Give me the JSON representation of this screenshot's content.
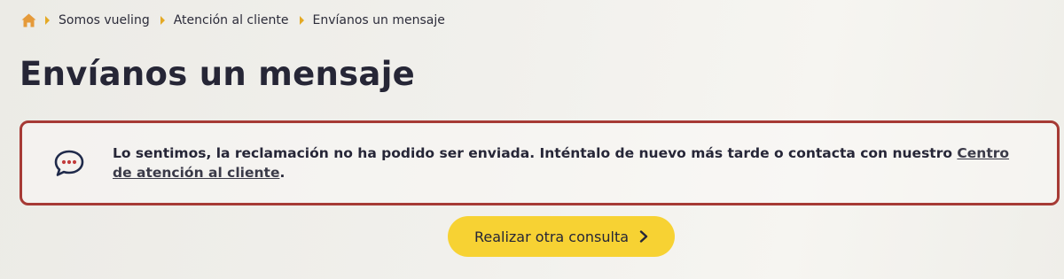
{
  "breadcrumb": {
    "home_icon": "home-icon",
    "items": [
      {
        "label": "Somos vueling"
      },
      {
        "label": "Atención al cliente"
      }
    ],
    "current": "Envíanos un mensaje"
  },
  "page": {
    "title": "Envíanos un mensaje"
  },
  "alert": {
    "icon": "chat-bubble-icon",
    "message": "Lo sentimos, la reclamación no ha podido ser enviada. Inténtalo de nuevo más tarde o contacta con nuestro",
    "link_text": "Centro de atención al cliente",
    "suffix": "."
  },
  "actions": {
    "retry_label": "Realizar otra consulta",
    "retry_icon": "chevron-right-icon"
  },
  "colors": {
    "accent_yellow": "#f7d233",
    "breadcrumb_separator": "#e4a924",
    "home_icon": "#e59a3a",
    "alert_border": "#a63a35",
    "text_dark": "#262637"
  }
}
